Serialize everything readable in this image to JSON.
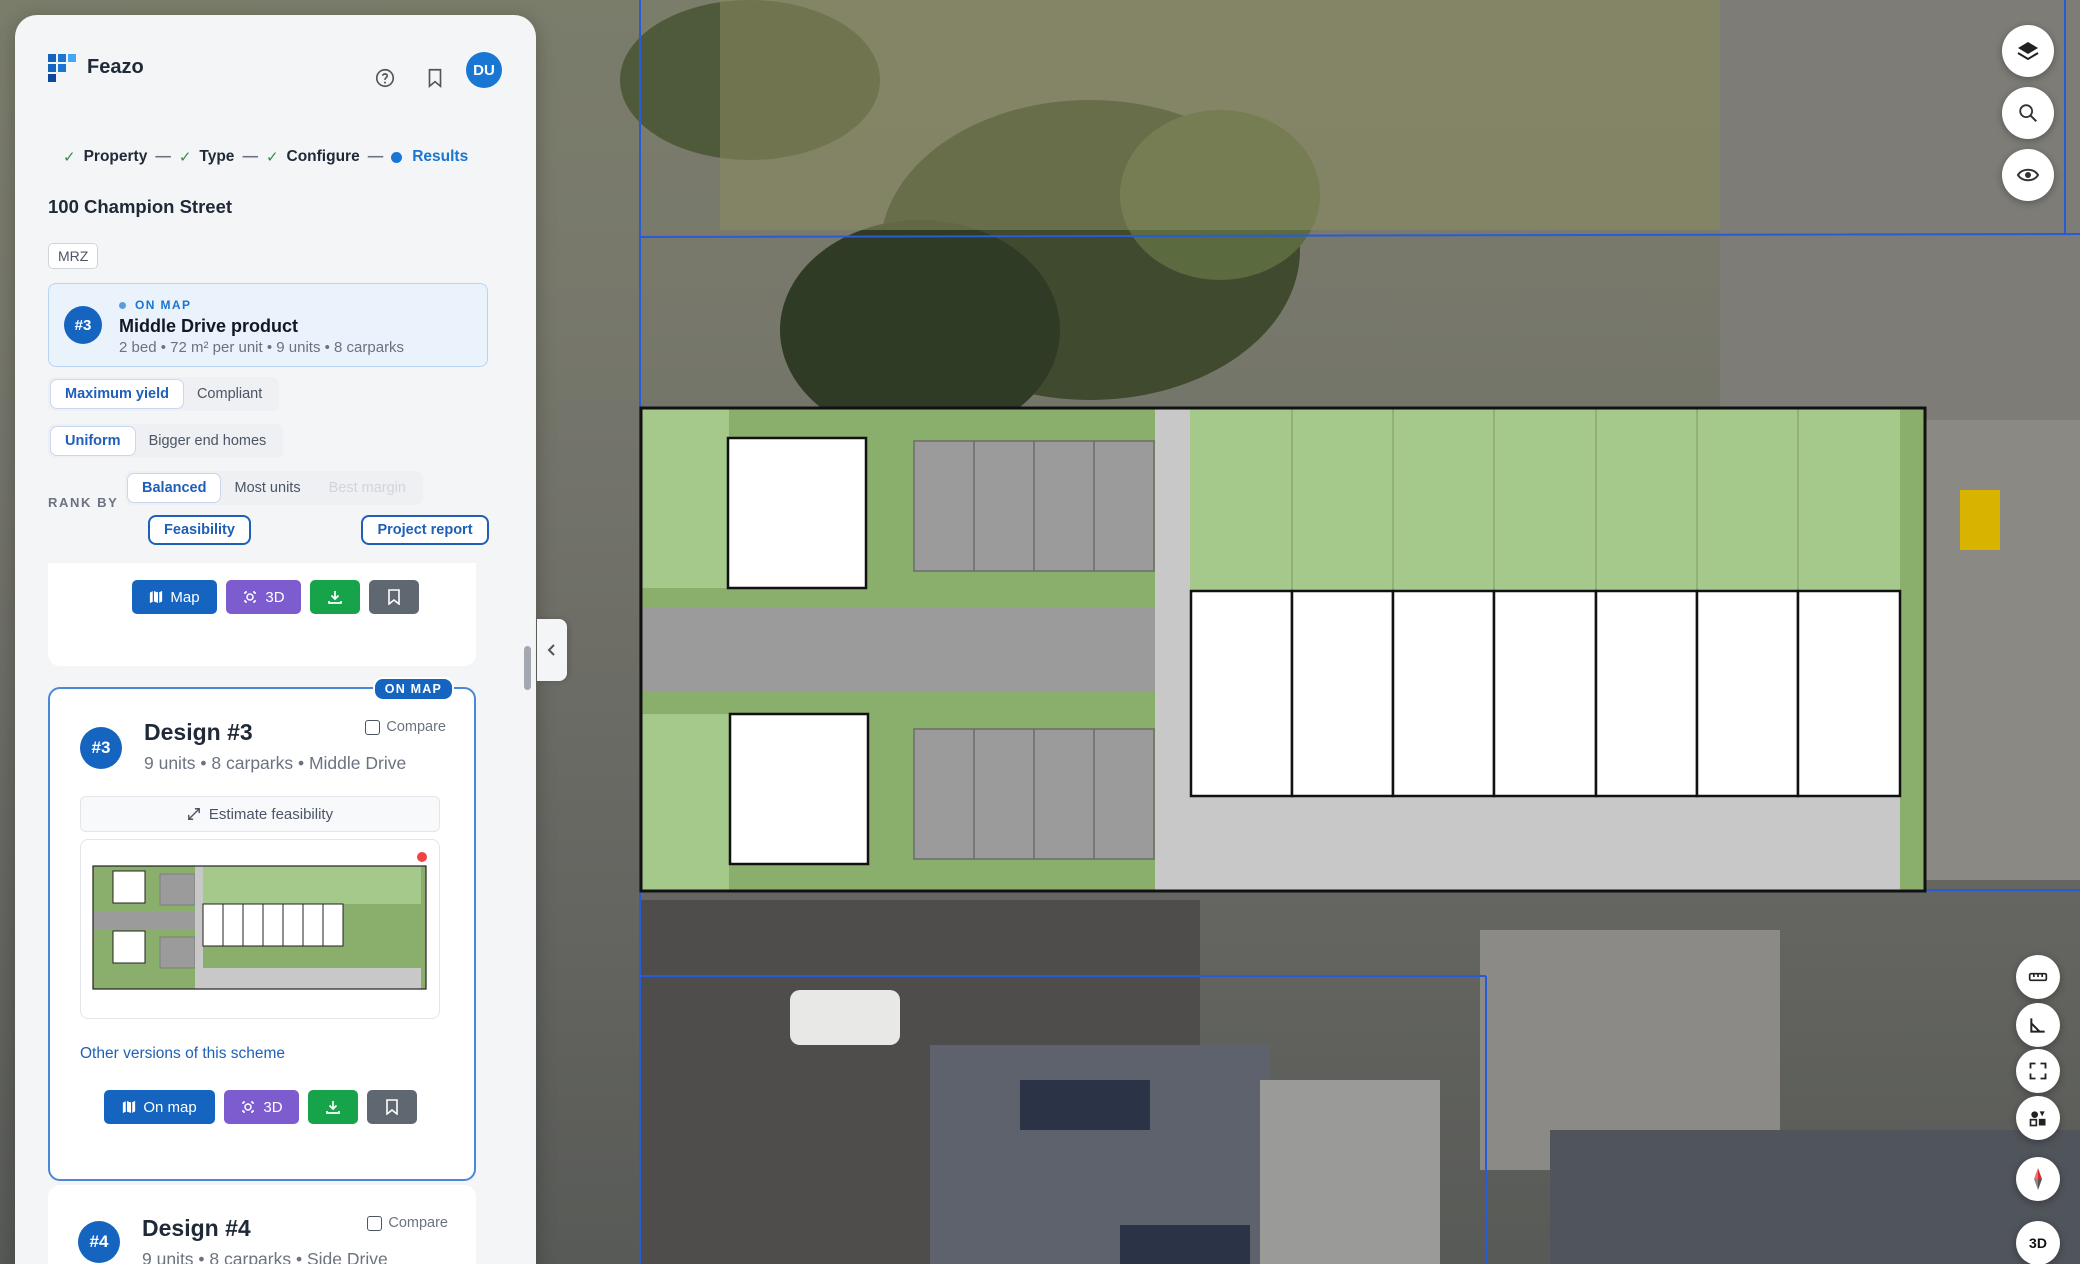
{
  "app": {
    "brand": "Feazo",
    "user_initials": "DU"
  },
  "steps": [
    {
      "label": "Property",
      "state": "done"
    },
    {
      "label": "Type",
      "state": "done"
    },
    {
      "label": "Configure",
      "state": "done"
    },
    {
      "label": "Results",
      "state": "active"
    }
  ],
  "property": {
    "address": "100 Champion Street",
    "zone": "MRZ"
  },
  "on_map": {
    "tag": "ON MAP",
    "number": "#3",
    "title": "Middle Drive product",
    "subtitle": "2 bed • 72 m² per unit • 9 units • 8 carparks"
  },
  "options": {
    "mode": [
      "Maximum yield",
      "Compliant"
    ],
    "distribution": [
      "Uniform",
      "Bigger end homes"
    ],
    "rank_label": "RANK BY",
    "rank": [
      "Balanced",
      "Most units",
      "Best margin"
    ]
  },
  "buttons": {
    "feasibility": "Feasibility",
    "project_report": "Project report"
  },
  "prev_card": {
    "map": "Map",
    "three_d": "3D"
  },
  "design3": {
    "pill": "ON MAP",
    "number": "#3",
    "title": "Design #3",
    "subtitle": "9 units • 8 carparks • Middle Drive",
    "compare": "Compare",
    "estimate": "Estimate feasibility",
    "others": "Other versions of this scheme",
    "on_map": "On map",
    "three_d": "3D"
  },
  "design4": {
    "number": "#4",
    "title": "Design #4",
    "subtitle": "9 units • 8 carparks • Side Drive",
    "compare": "Compare"
  },
  "map_controls": {
    "three_d": "3D"
  },
  "colors": {
    "accent": "#1565c0",
    "purple": "#7c5ccf",
    "green": "#16a34a",
    "parcel_line": "#2a5bd7",
    "lawn": "#a5c98a",
    "garden": "#8aae6b",
    "paving": "#9b9b9b"
  }
}
